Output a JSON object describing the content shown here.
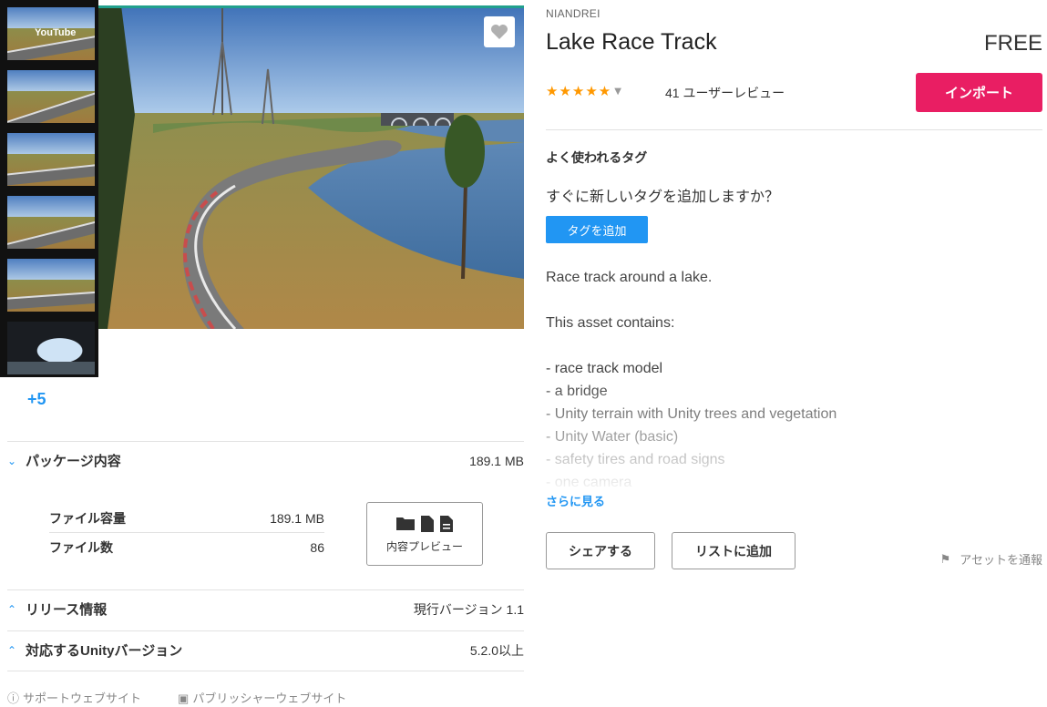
{
  "gallery": {
    "thumbnails": [
      {
        "label": "YouTube"
      },
      {
        "label": ""
      },
      {
        "label": ""
      },
      {
        "label": ""
      },
      {
        "label": ""
      },
      {
        "label": ""
      }
    ],
    "more_count": "+5"
  },
  "package": {
    "contents_title": "パッケージ内容",
    "contents_size": "189.1 MB",
    "file_size_label": "ファイル容量",
    "file_size_value": "189.1 MB",
    "file_count_label": "ファイル数",
    "file_count_value": "86",
    "preview_button_label": "内容プレビュー",
    "release_title": "リリース情報",
    "release_value": "現行バージョン 1.1",
    "unity_title": "対応するUnityバージョン",
    "unity_value": "5.2.0以上"
  },
  "footer": {
    "support_link": "サポートウェブサイト",
    "publisher_link": "パブリッシャーウェブサイト"
  },
  "asset": {
    "publisher": "NIANDREI",
    "title": "Lake Race Track",
    "price": "FREE",
    "stars": "★★★★★",
    "rating": 5,
    "reviews": "41 ユーザーレビュー",
    "import_label": "インポート"
  },
  "tags": {
    "heading": "よく使われるタグ",
    "question": "すぐに新しいタグを追加しますか？",
    "add_label": "タグを追加"
  },
  "description": {
    "lines": [
      "Race track around a lake.",
      "",
      "This asset contains:",
      "",
      "- race track model",
      "- a bridge",
      "- Unity terrain with Unity trees and vegetation",
      "- Unity Water (basic)",
      "- safety tires and road signs",
      "- one camera"
    ],
    "see_more": "さらに見る"
  },
  "actions": {
    "share_label": "シェアする",
    "add_list_label": "リストに追加",
    "report_label": "アセットを通報"
  },
  "colors": {
    "accent_blue": "#2196f3",
    "import_pink": "#e91e63",
    "star_orange": "#ff9800"
  }
}
